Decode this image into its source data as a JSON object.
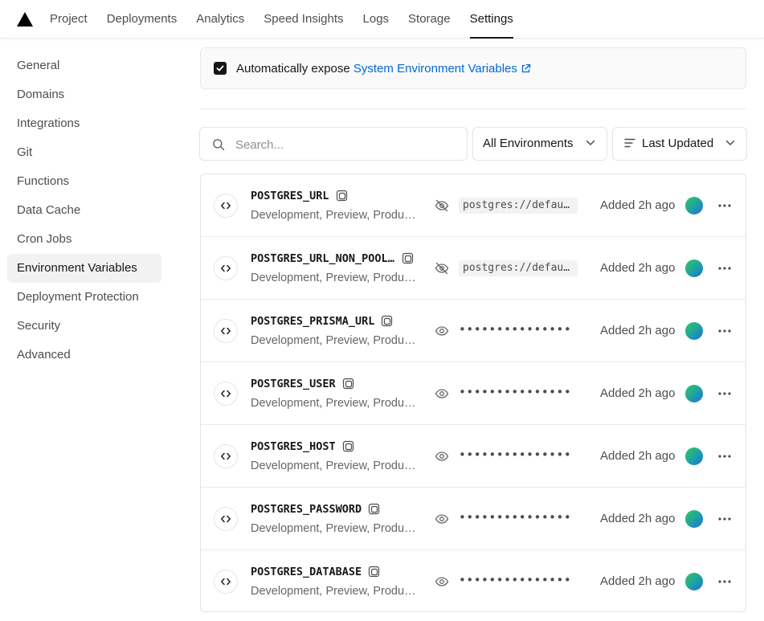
{
  "nav": {
    "logo": "vercel-triangle",
    "tabs": [
      {
        "label": "Project",
        "active": false
      },
      {
        "label": "Deployments",
        "active": false
      },
      {
        "label": "Analytics",
        "active": false
      },
      {
        "label": "Speed Insights",
        "active": false
      },
      {
        "label": "Logs",
        "active": false
      },
      {
        "label": "Storage",
        "active": false
      },
      {
        "label": "Settings",
        "active": true
      }
    ]
  },
  "sidebar": {
    "items": [
      {
        "label": "General",
        "active": false
      },
      {
        "label": "Domains",
        "active": false
      },
      {
        "label": "Integrations",
        "active": false
      },
      {
        "label": "Git",
        "active": false
      },
      {
        "label": "Functions",
        "active": false
      },
      {
        "label": "Data Cache",
        "active": false
      },
      {
        "label": "Cron Jobs",
        "active": false
      },
      {
        "label": "Environment Variables",
        "active": true
      },
      {
        "label": "Deployment Protection",
        "active": false
      },
      {
        "label": "Security",
        "active": false
      },
      {
        "label": "Advanced",
        "active": false
      }
    ]
  },
  "expose": {
    "checked": true,
    "text": "Automatically expose",
    "link": "System Environment Variables"
  },
  "filters": {
    "search_placeholder": "Search...",
    "search_value": "",
    "environment": "All Environments",
    "sort": "Last Updated"
  },
  "variables": [
    {
      "name": "POSTGRES_URL",
      "environments": "Development, Preview, Production",
      "value": "postgres://default:",
      "hidden": false,
      "added": "Added 2h ago"
    },
    {
      "name": "POSTGRES_URL_NON_POOLING",
      "environments": "Development, Preview, Production",
      "value": "postgres://default:",
      "hidden": false,
      "added": "Added 2h ago"
    },
    {
      "name": "POSTGRES_PRISMA_URL",
      "environments": "Development, Preview, Production",
      "value": "•••••••••••••••",
      "hidden": true,
      "added": "Added 2h ago"
    },
    {
      "name": "POSTGRES_USER",
      "environments": "Development, Preview, Production",
      "value": "•••••••••••••••",
      "hidden": true,
      "added": "Added 2h ago"
    },
    {
      "name": "POSTGRES_HOST",
      "environments": "Development, Preview, Production",
      "value": "•••••••••••••••",
      "hidden": true,
      "added": "Added 2h ago"
    },
    {
      "name": "POSTGRES_PASSWORD",
      "environments": "Development, Preview, Production",
      "value": "•••••••••••••••",
      "hidden": true,
      "added": "Added 2h ago"
    },
    {
      "name": "POSTGRES_DATABASE",
      "environments": "Development, Preview, Production",
      "value": "•••••••••••••••",
      "hidden": true,
      "added": "Added 2h ago"
    }
  ],
  "colors": {
    "accent_link": "#0068d6",
    "text_primary": "#171717",
    "text_secondary": "#666666",
    "active_bg": "#f2f2f2"
  }
}
